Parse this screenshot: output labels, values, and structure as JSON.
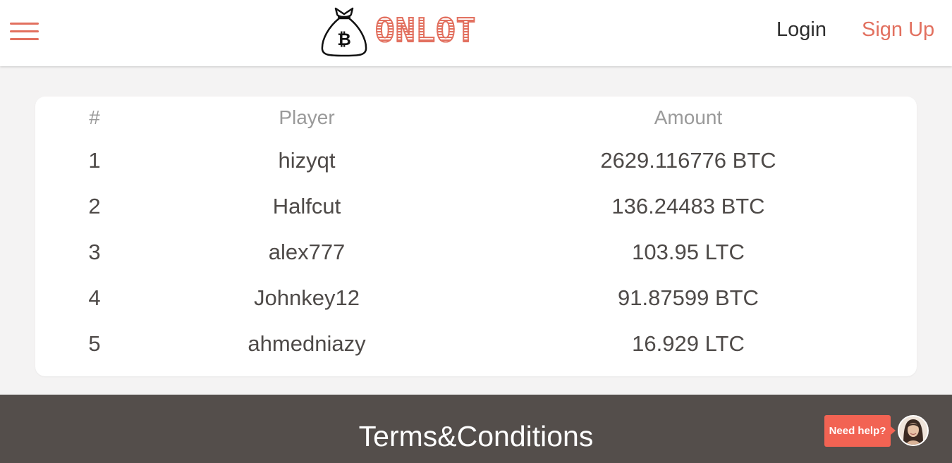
{
  "colors": {
    "accent": "#e2705f",
    "header_bg": "#ffffff",
    "page_bg": "#f4f3f3",
    "footer_bg": "#544e4b",
    "help_bg": "#f26353"
  },
  "header": {
    "menu_icon": "hamburger-icon",
    "logo_icon": "bitcoin-money-bag-icon",
    "logo_text": "ONLOT",
    "login_label": "Login",
    "signup_label": "Sign Up"
  },
  "leaderboard": {
    "columns": [
      "#",
      "Player",
      "Amount"
    ],
    "rows": [
      {
        "rank": "1",
        "player": "hizyqt",
        "amount": "2629.116776 BTC"
      },
      {
        "rank": "2",
        "player": "Halfcut",
        "amount": "136.24483 BTC"
      },
      {
        "rank": "3",
        "player": "alex777",
        "amount": "103.95 LTC"
      },
      {
        "rank": "4",
        "player": "Johnkey12",
        "amount": "91.87599 BTC"
      },
      {
        "rank": "5",
        "player": "ahmedniazy",
        "amount": "16.929 LTC"
      }
    ]
  },
  "footer": {
    "title": "Terms&Conditions"
  },
  "help_widget": {
    "label": "Need help?",
    "avatar_icon": "support-agent-avatar"
  }
}
